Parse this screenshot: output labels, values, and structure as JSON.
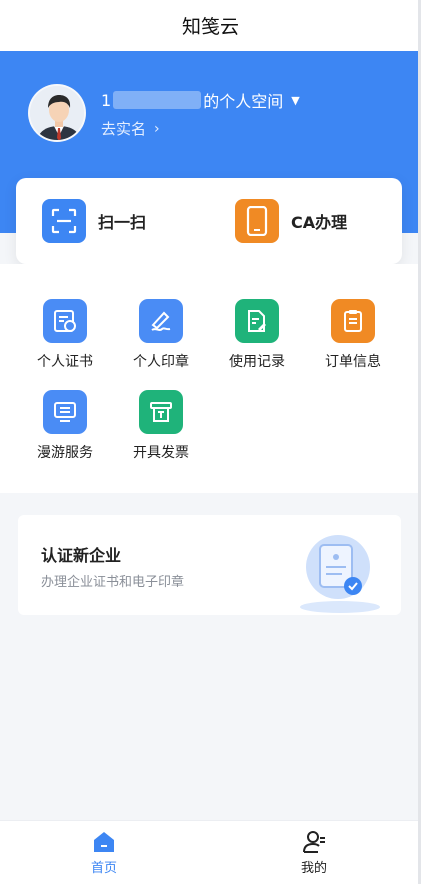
{
  "app": {
    "title": "知笺云"
  },
  "profile": {
    "space_prefix": "1",
    "space_suffix": "的个人空间",
    "verify_label": "去实名"
  },
  "quick_actions": [
    {
      "label": "扫一扫",
      "icon": "scan-icon",
      "color": "#3d86f3"
    },
    {
      "label": "CA办理",
      "icon": "phone-icon",
      "color": "#f08a24"
    }
  ],
  "grid": [
    {
      "label": "个人证书",
      "icon": "certificate-icon",
      "color": "#4a8cf5"
    },
    {
      "label": "个人印章",
      "icon": "pen-signature-icon",
      "color": "#4a8cf5"
    },
    {
      "label": "使用记录",
      "icon": "document-edit-icon",
      "color": "#1fb37a"
    },
    {
      "label": "订单信息",
      "icon": "clipboard-icon",
      "color": "#f08a24"
    },
    {
      "label": "漫游服务",
      "icon": "monitor-icon",
      "color": "#4a8cf5"
    },
    {
      "label": "开具发票",
      "icon": "invoice-icon",
      "color": "#1fb37a"
    }
  ],
  "enterprise": {
    "title": "认证新企业",
    "subtitle": "办理企业证书和电子印章",
    "icon": "certified-document-icon"
  },
  "tabs": [
    {
      "label": "首页",
      "icon": "home-icon",
      "active": true,
      "color": "#3d86f3"
    },
    {
      "label": "我的",
      "icon": "user-icon",
      "active": false,
      "color": "#222222"
    }
  ]
}
